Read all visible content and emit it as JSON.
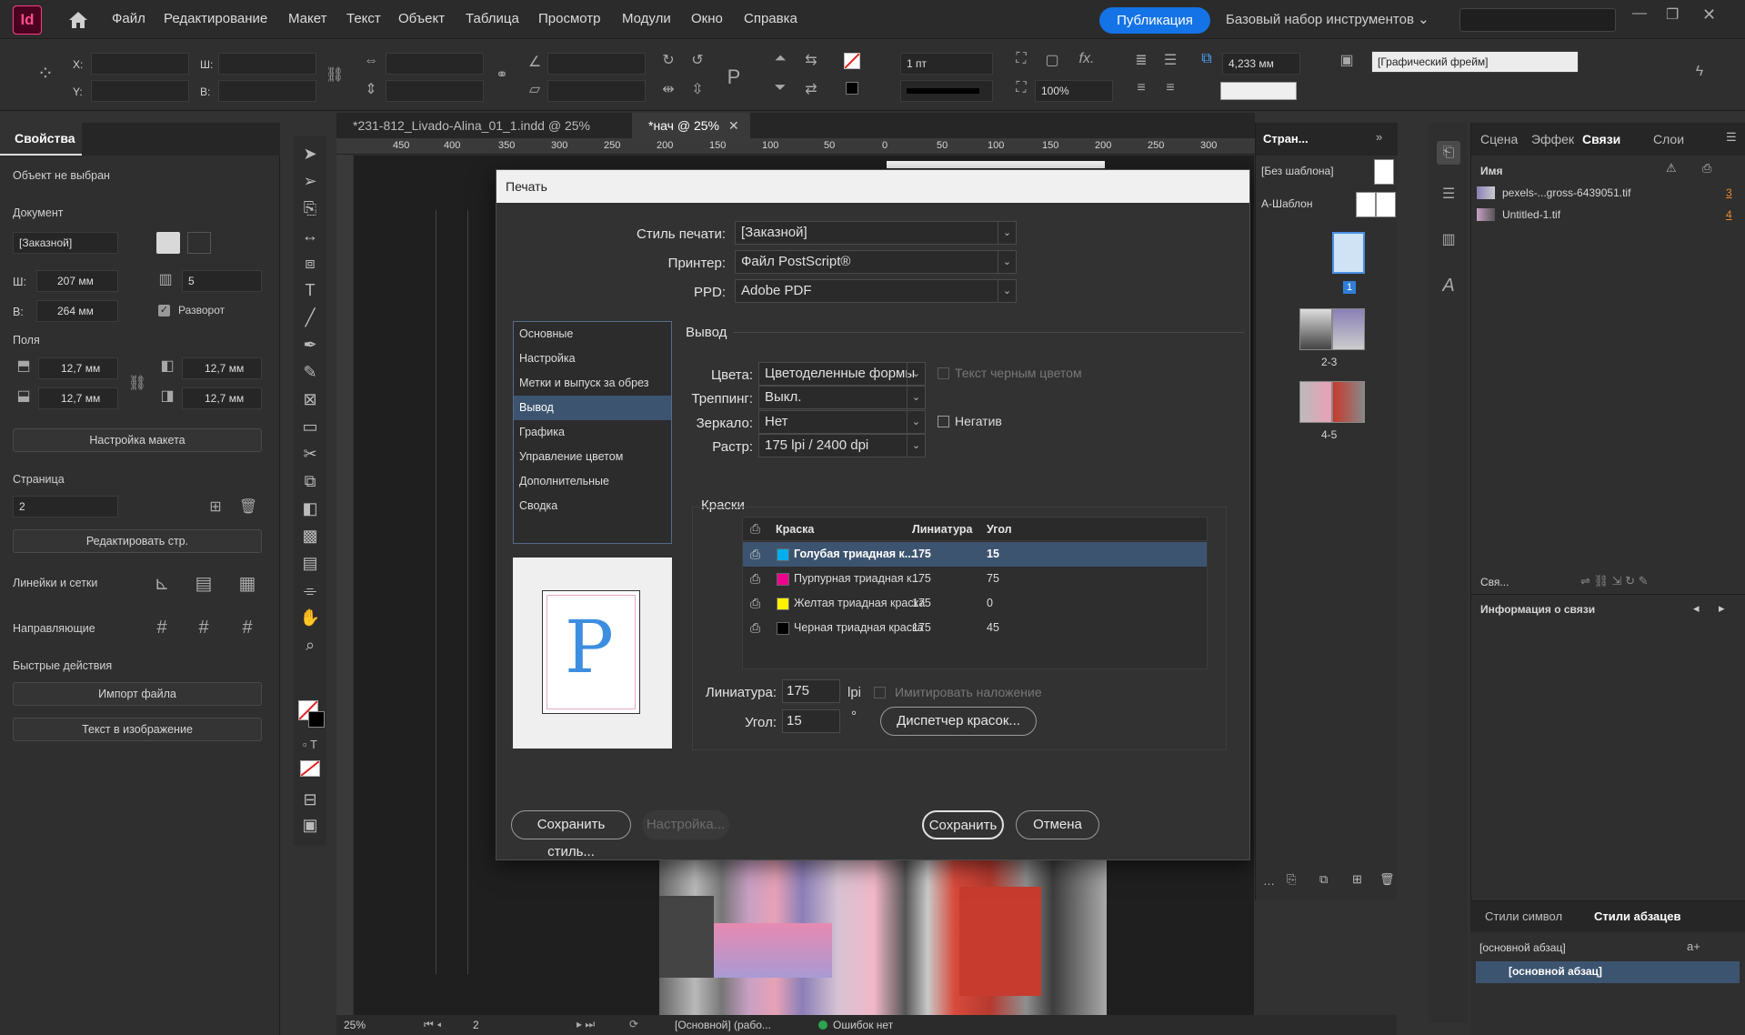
{
  "app": {
    "logo": "Id",
    "menu": [
      "Файл",
      "Редактирование",
      "Макет",
      "Текст",
      "Объект",
      "Таблица",
      "Просмотр",
      "Модули",
      "Окно",
      "Справка"
    ],
    "publish": "Публикация",
    "workspace": "Базовый набор инструментов ⌄"
  },
  "control": {
    "x_label": "X:",
    "y_label": "Y:",
    "w_label": "Ш:",
    "h_label": "В:",
    "stroke": "1 пт",
    "zoom": "100%",
    "measure": "4,233 мм",
    "frame_style": "[Графический фрейм]"
  },
  "properties": {
    "tab": "Свойства",
    "no_object": "Объект не выбран",
    "document": "Документ",
    "preset": "[Заказной]",
    "width_label": "Ш:",
    "width": "207 мм",
    "height_label": "В:",
    "height": "264 мм",
    "pages": "5",
    "spread": "Разворот",
    "margins": "Поля",
    "m_top": "12,7 мм",
    "m_bottom": "12,7 мм",
    "m_left": "12,7 мм",
    "m_right": "12,7 мм",
    "layout_btn": "Настройка макета",
    "page_section": "Страница",
    "page_value": "2",
    "edit_page_btn": "Редактировать стр.",
    "rulers": "Линейки и сетки",
    "guides": "Направляющие",
    "quick": "Быстрые действия",
    "import_btn": "Импорт файла",
    "text_btn": "Текст в изображение"
  },
  "tabs": {
    "doc1": "*231-812_Livado-Alina_01_1.indd @ 25%",
    "doc2": "*нач @ 25%"
  },
  "ruler": [
    "450",
    "400",
    "350",
    "300",
    "250",
    "200",
    "150",
    "100",
    "50",
    "0",
    "50",
    "100",
    "150",
    "200",
    "250",
    "300"
  ],
  "dialog": {
    "title": "Печать",
    "style_label": "Стиль печати:",
    "style": "[Заказной]",
    "printer_label": "Принтер:",
    "printer": "Файл PostScript®",
    "ppd_label": "PPD:",
    "ppd": "Adobe PDF",
    "nav": [
      "Основные",
      "Настройка",
      "Метки и выпуск за обрез",
      "Вывод",
      "Графика",
      "Управление цветом",
      "Дополнительные",
      "Сводка"
    ],
    "section": "Вывод",
    "colors_label": "Цвета:",
    "colors": "Цветоделенные формы",
    "text_black": "Текст черным цветом",
    "trap_label": "Треппинг:",
    "trap": "Выкл.",
    "mirror_label": "Зеркало:",
    "mirror": "Нет",
    "negative": "Негатив",
    "raster_label": "Растр:",
    "raster": "175 lpi / 2400 dpi",
    "inks_label": "Краски",
    "ink_head": {
      "ink": "Краска",
      "freq": "Линиатура",
      "angle": "Угол"
    },
    "inks": [
      {
        "name": "Голубая триадная к...",
        "freq": "175",
        "angle": "15",
        "color": "#00aeef"
      },
      {
        "name": "Пурпурная триадная к...",
        "freq": "175",
        "angle": "75",
        "color": "#ec008c"
      },
      {
        "name": "Желтая триадная краска",
        "freq": "175",
        "angle": "0",
        "color": "#fff200"
      },
      {
        "name": "Черная триадная краска",
        "freq": "175",
        "angle": "45",
        "color": "#000000"
      }
    ],
    "freq_label": "Линиатура:",
    "freq": "175",
    "lpi": "lpi",
    "angle_label": "Угол:",
    "angle": "15",
    "deg": "°",
    "simulate": "Имитировать наложение",
    "ink_manager": "Диспетчер красок...",
    "save_style": "Сохранить стиль...",
    "setup": "Настройка...",
    "save": "Сохранить",
    "cancel": "Отмена",
    "preview_letter": "P"
  },
  "pages_panel": {
    "title": "Стран...",
    "none": "[Без шаблона]",
    "master": "А-Шаблон",
    "p1": "1",
    "p23": "2-3",
    "p45": "4-5"
  },
  "links_panel": {
    "tabs": [
      "Сцена",
      "Эффек",
      "Связи",
      "Слои"
    ],
    "name_col": "Имя",
    "links": [
      {
        "name": "pexels-...gross-6439051.tif",
        "page": "3"
      },
      {
        "name": "Untitled-1.tif",
        "page": "4"
      }
    ],
    "sv": "Свя...",
    "info": "Информация о связи"
  },
  "styles_panel": {
    "tabs": [
      "Стили символ",
      "Стили абзацев"
    ],
    "current": "[основной абзац]",
    "item": "[основной абзац]"
  },
  "status": {
    "zoom": "25%",
    "page": "2",
    "profile": "[Основной] (рабо...",
    "errors": "Ошибок нет"
  }
}
